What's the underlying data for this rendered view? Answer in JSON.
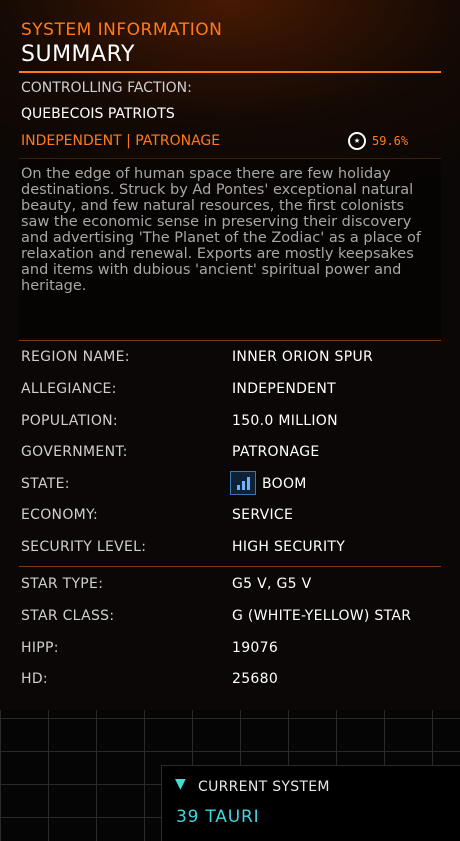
{
  "header": {
    "section": "SYSTEM INFORMATION",
    "title": "SUMMARY"
  },
  "faction": {
    "label": "CONTROLLING FACTION:",
    "name": "QUEBECOIS PATRIOTS",
    "meta": "INDEPENDENT | PATRONAGE",
    "influence": "59.6%"
  },
  "description": "On the edge of human space there are few holiday destinations. Struck by Ad Pontes' exceptional natural beauty, and few natural resources, the first colonists saw the economic sense in preserving their discovery and advertising 'The Planet of the Zodiac' as a place of relaxation and renewal. Exports are mostly keepsakes and items with dubious 'ancient' spiritual power and heritage.",
  "details": [
    {
      "label": "REGION NAME:",
      "value": "INNER ORION SPUR"
    },
    {
      "label": "ALLEGIANCE:",
      "value": "INDEPENDENT"
    },
    {
      "label": "POPULATION:",
      "value": "150.0 MILLION"
    },
    {
      "label": "GOVERNMENT:",
      "value": "PATRONAGE"
    },
    {
      "label": "STATE:",
      "value": "BOOM"
    },
    {
      "label": "ECONOMY:",
      "value": "SERVICE"
    },
    {
      "label": "SECURITY LEVEL:",
      "value": "HIGH SECURITY"
    }
  ],
  "star": [
    {
      "label": "STAR TYPE:",
      "value": "G5 V, G5 V"
    },
    {
      "label": "STAR CLASS:",
      "value": "G (WHITE-YELLOW) STAR"
    },
    {
      "label": "HIPP:",
      "value": "19076"
    },
    {
      "label": "HD:",
      "value": "25680"
    }
  ],
  "current_system": {
    "label": "CURRENT SYSTEM",
    "name": "39 TAURI"
  },
  "icons": {
    "influence": "star-badge-icon",
    "state": "boom-chart-icon",
    "location": "location-pin-icon"
  },
  "colors": {
    "accent": "#ff7a1a",
    "current": "#3fd6e0",
    "boom": "#68b4ff"
  }
}
